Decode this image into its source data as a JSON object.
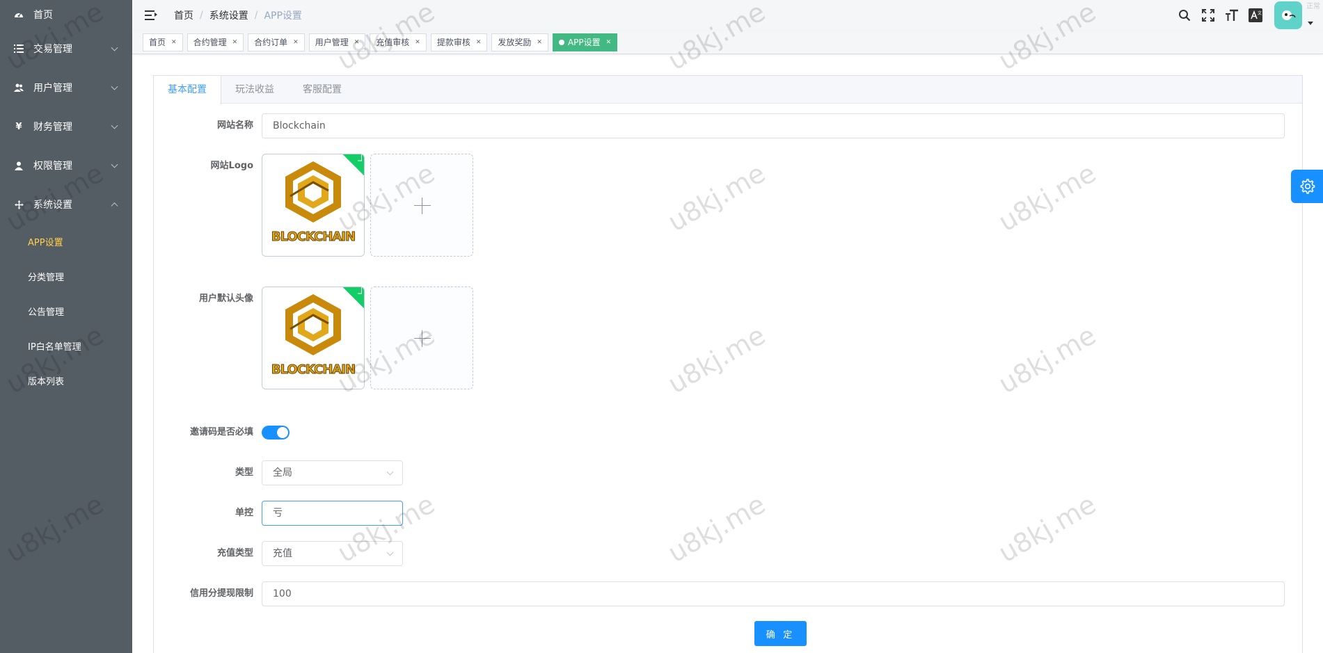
{
  "sidebar": {
    "items": [
      {
        "label": "首页",
        "icon": "dashboard-icon"
      },
      {
        "label": "交易管理",
        "icon": "list-icon",
        "expandable": true
      },
      {
        "label": "用户管理",
        "icon": "users-icon",
        "expandable": true
      },
      {
        "label": "财务管理",
        "icon": "yen-icon",
        "expandable": true
      },
      {
        "label": "权限管理",
        "icon": "user-icon",
        "expandable": true
      },
      {
        "label": "系统设置",
        "icon": "move-icon",
        "expandable": true,
        "expanded": true
      }
    ],
    "sub_items": [
      "APP设置",
      "分类管理",
      "公告管理",
      "IP白名单管理",
      "版本列表"
    ],
    "active_sub": "APP设置"
  },
  "header": {
    "breadcrumb": [
      "首页",
      "系统设置",
      "APP设置"
    ],
    "corner_text": "正常"
  },
  "tags": [
    "首页",
    "合约管理",
    "合约订单",
    "用户管理",
    "充值审核",
    "提款审核",
    "发放奖励",
    "APP设置"
  ],
  "tabs": [
    "基本配置",
    "玩法收益",
    "客服配置"
  ],
  "form": {
    "site_name": {
      "label": "网站名称",
      "value": "Blockchain"
    },
    "site_logo": {
      "label": "网站Logo",
      "image_text": "BLOCKCHAIN"
    },
    "default_avatar": {
      "label": "用户默认头像",
      "image_text": "BLOCKCHAIN"
    },
    "invite_required": {
      "label": "邀请码是否必填",
      "on": true
    },
    "type": {
      "label": "类型",
      "value": "全局"
    },
    "single_control": {
      "label": "单控",
      "value": "亏"
    },
    "recharge_type": {
      "label": "充值类型",
      "value": "充值"
    },
    "credit_limit": {
      "label": "信用分提现限制",
      "value": "100"
    },
    "submit_label": "确 定"
  },
  "watermark": "u8kj.me",
  "colors": {
    "sidebar": "#545c64",
    "active_menu": "#ffd04b",
    "primary": "#1890ff",
    "tag_active": "#42b983"
  }
}
